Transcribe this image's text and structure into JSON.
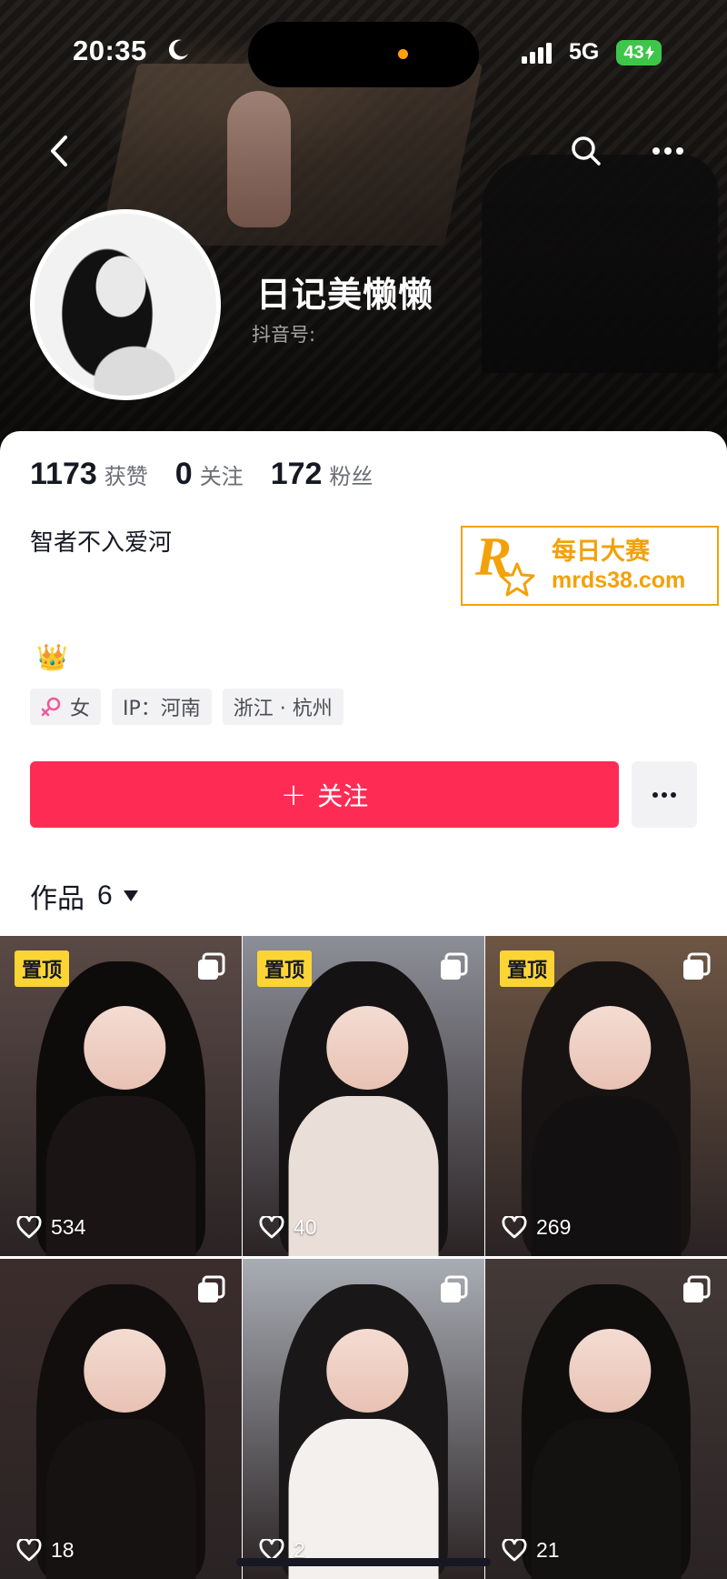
{
  "status_bar": {
    "time": "20:35",
    "network": "5G",
    "battery": "43"
  },
  "profile": {
    "name": "日记美懒懒",
    "douyin_id_label": "抖音号:",
    "stats": [
      {
        "value": "1173",
        "label": "获赞"
      },
      {
        "value": "0",
        "label": "关注"
      },
      {
        "value": "172",
        "label": "粉丝"
      }
    ],
    "bio": "智者不入爱河",
    "bio_emoji": "👑",
    "tags": {
      "gender": "女",
      "ip": "IP：河南",
      "location": "浙江 · 杭州"
    }
  },
  "watermark": {
    "logo_letter": "R",
    "name": "每日大赛",
    "url": "mrds38.com"
  },
  "actions": {
    "follow_label": "关注"
  },
  "works": {
    "label": "作品",
    "count": "6",
    "items": [
      {
        "pinned": "置顶",
        "likes": "534",
        "bg": "#5a4a46",
        "outfit": "#1a1414",
        "hair": "#0e0b0b"
      },
      {
        "pinned": "置顶",
        "likes": "40",
        "bg": "#8d8f98",
        "outfit": "#e9ded8",
        "hair": "#141213"
      },
      {
        "pinned": "置顶",
        "likes": "269",
        "bg": "#6e5644",
        "outfit": "#121010",
        "hair": "#171312"
      },
      {
        "pinned": "",
        "likes": "18",
        "bg": "#3b2d2c",
        "outfit": "#161212",
        "hair": "#120e0e"
      },
      {
        "pinned": "",
        "likes": "2",
        "bg": "#a9adb4",
        "outfit": "#f4f0ee",
        "hair": "#1a1718"
      },
      {
        "pinned": "",
        "likes": "21",
        "bg": "#433a38",
        "outfit": "#141111",
        "hair": "#100d0d"
      }
    ]
  }
}
